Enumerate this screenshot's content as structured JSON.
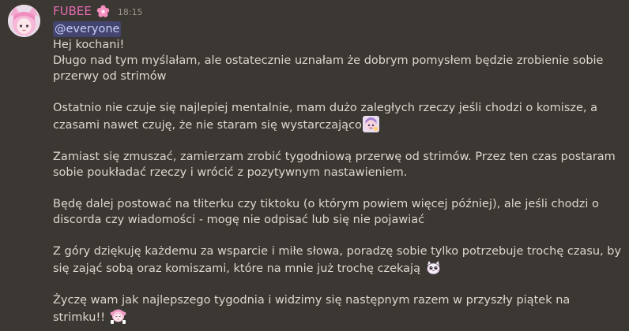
{
  "author": {
    "name": "FUBEE",
    "name_color": "#e86ab2",
    "avatar_icon": "anime-avatar",
    "role_icon": "pink-flower-icon",
    "timestamp": "18:15"
  },
  "message": {
    "mention": "@everyone",
    "paragraphs": [
      "Hej kochani!\nDługo nad tym myślałam, ale ostatecznie uznałam że dobrym pomysłem będzie zrobienie sobie przerwy od strimów",
      "Ostatnio nie czuje się najlepiej mentalnie, mam dużo zaległych rzeczy jeśli chodzi o komisze, a czasami nawet czuję, że nie staram się wystarczająco",
      "Zamiast się zmuszać, zamierzam zrobić tygodniową przerwę od strimów. Przez ten czas postaram sobie poukładać rzeczy i wrócić z pozytywnym nastawieniem.",
      "Będę dalej postować na tłiterku czy tiktoku (o którym powiem więcej później), ale jeśli chodzi o discorda czy wiadomości - mogę nie odpisać lub się nie pojawiać",
      "Z góry dziękuję każdemu za wsparcie i miłe słowa, poradzę sobie tylko potrzebuje trochę czasu, by się zająć sobą oraz komiszami, które na mnie już trochę czekają",
      "Życzę wam jak najlepszego tygodnia i widzimy się następnym razem w przyszły piątek na strimku!!"
    ],
    "emojis": [
      "sad-anime-emoji",
      "crying-cat-emoji",
      "cheering-girl-emoji"
    ]
  },
  "colors": {
    "background": "#3b3732",
    "text": "#ddd8cf",
    "mention_bg": "#4a4d8c",
    "mention_text": "#c9cdfb",
    "timestamp": "#9a958d"
  }
}
